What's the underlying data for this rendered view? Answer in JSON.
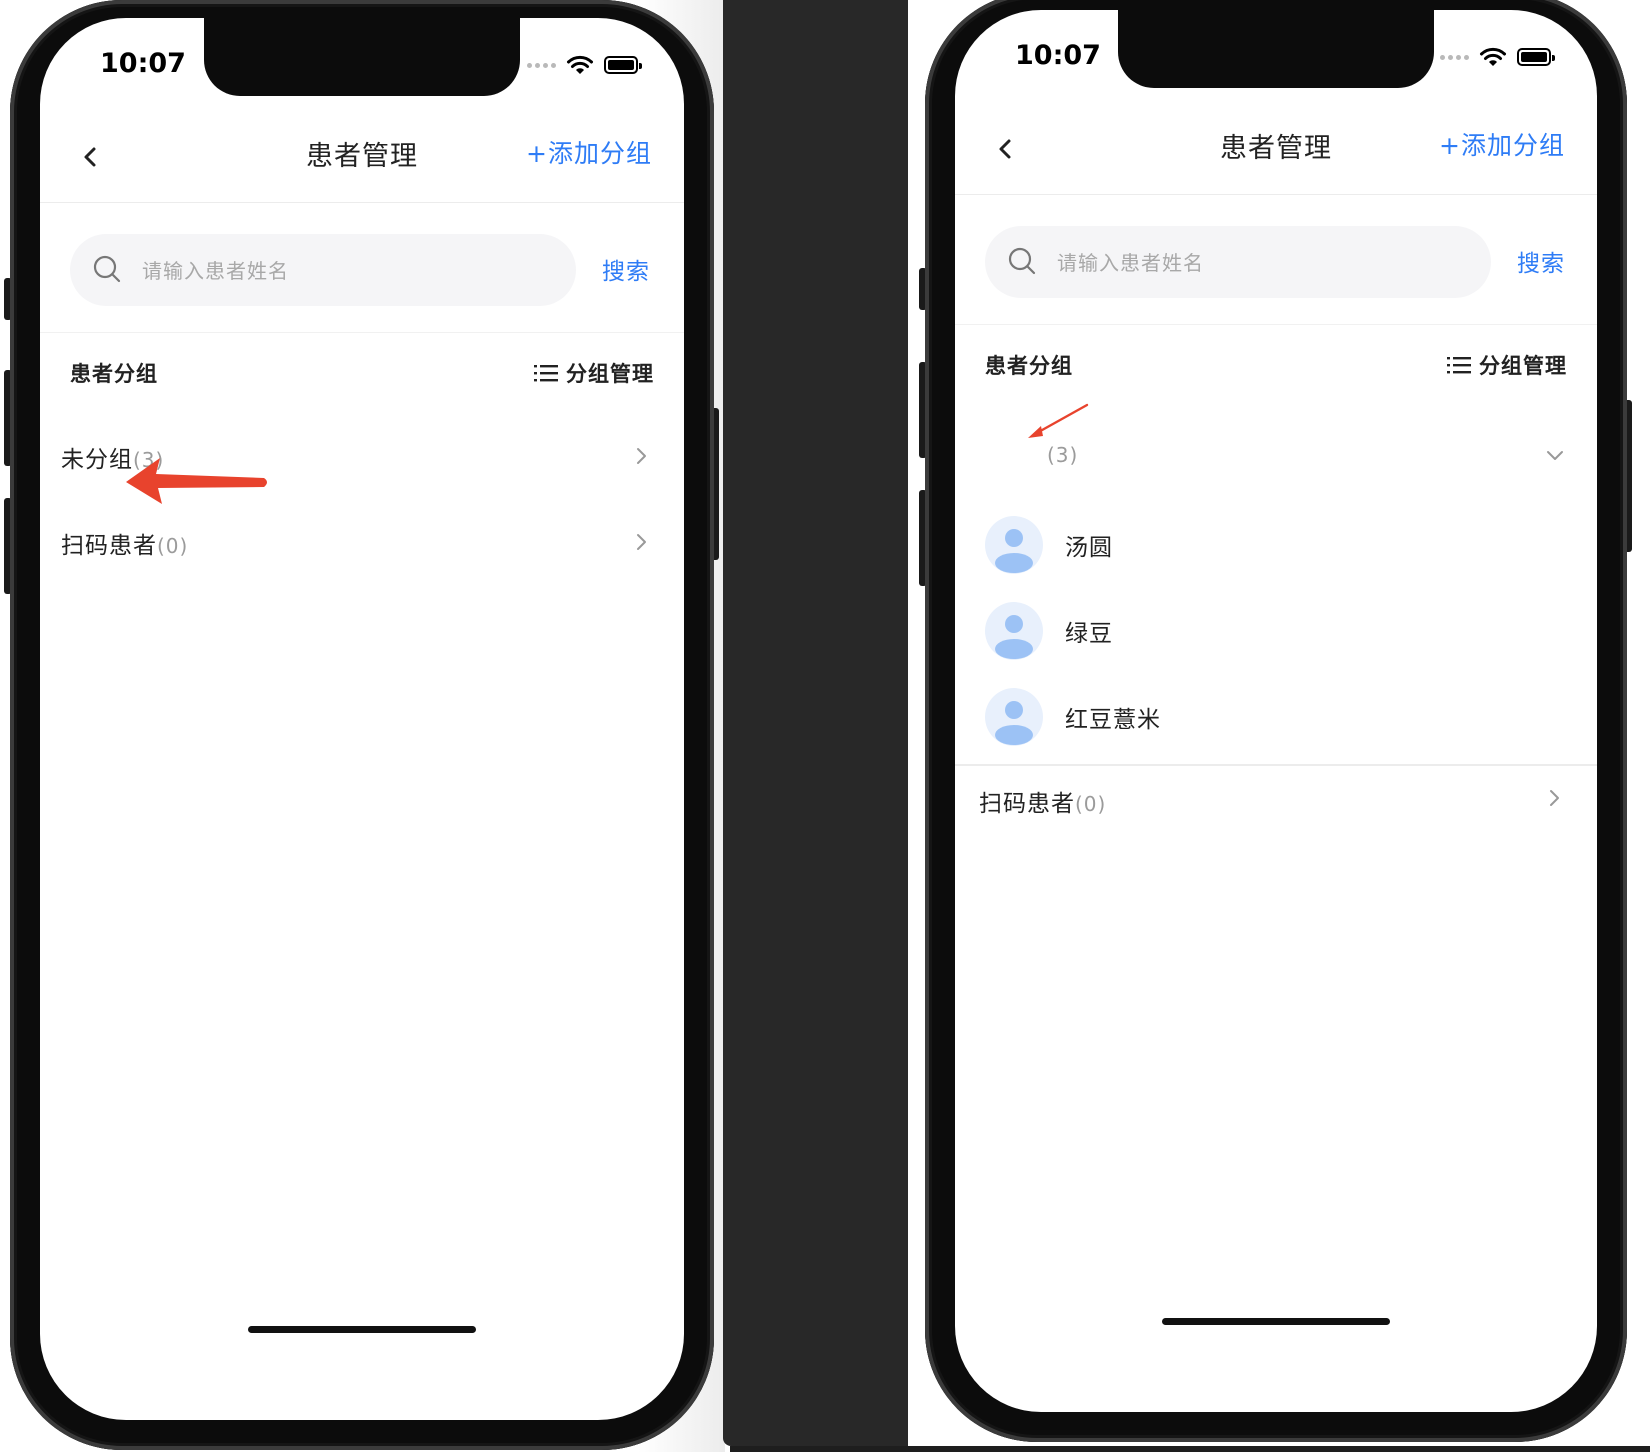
{
  "colors": {
    "accent": "#2e7cf6",
    "annotation_arrow": "#e8432d",
    "avatar_fg": "#9cc2f5",
    "avatar_bg": "#e8f0fc"
  },
  "left_phone": {
    "status": {
      "time": "10:07"
    },
    "nav": {
      "back_icon": "chevron-left-icon",
      "title": "患者管理",
      "action": "+添加分组"
    },
    "search": {
      "placeholder": "请输入患者姓名",
      "button": "搜索"
    },
    "section": {
      "title": "患者分组",
      "manage_label": "分组管理",
      "manage_icon": "list-icon"
    },
    "groups": [
      {
        "name": "未分组",
        "count": "(3)",
        "expanded": false
      },
      {
        "name": "扫码患者",
        "count": "(0)",
        "expanded": false
      }
    ]
  },
  "right_phone": {
    "status": {
      "time": "10:07"
    },
    "nav": {
      "back_icon": "chevron-left-icon",
      "title": "患者管理",
      "action": "+添加分组"
    },
    "search": {
      "placeholder": "请输入患者姓名",
      "button": "搜索"
    },
    "section": {
      "title": "患者分组",
      "manage_label": "分组管理",
      "manage_icon": "list-icon"
    },
    "expanded_group": {
      "name": "",
      "count": "(3)",
      "expanded": true
    },
    "patients": [
      {
        "name": "汤圆",
        "avatar": "person-avatar-icon"
      },
      {
        "name": "绿豆",
        "avatar": "person-avatar-icon"
      },
      {
        "name": "红豆薏米",
        "avatar": "person-avatar-icon"
      }
    ],
    "groups": [
      {
        "name": "扫码患者",
        "count": "(0)",
        "expanded": false
      }
    ]
  }
}
